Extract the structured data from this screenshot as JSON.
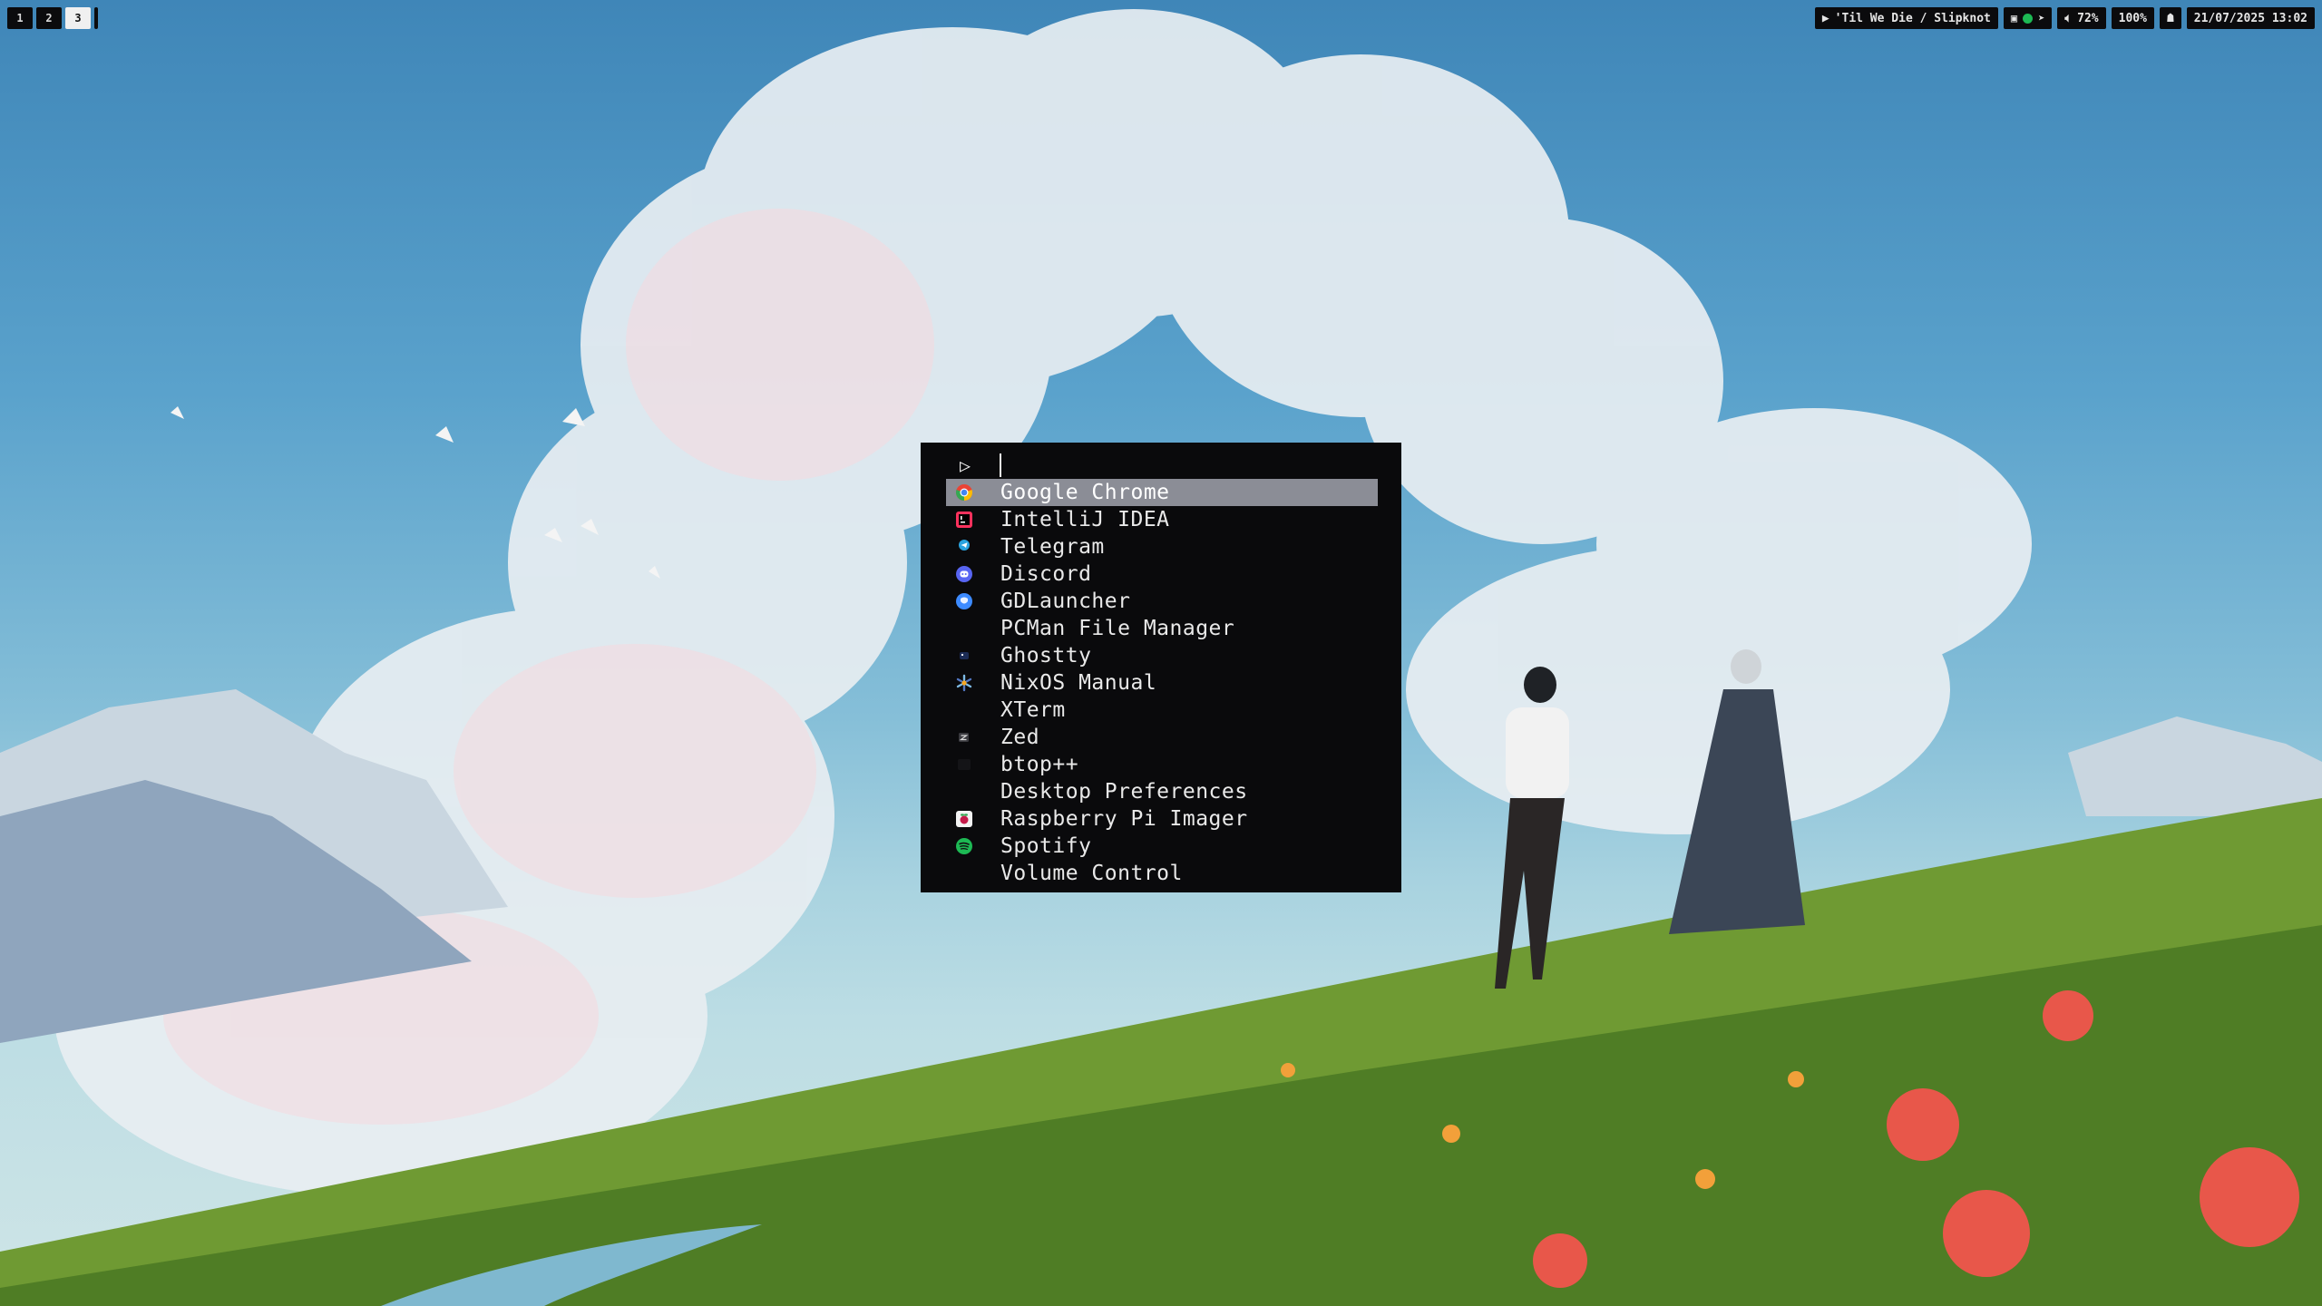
{
  "workspaces": [
    {
      "label": "1",
      "active": false
    },
    {
      "label": "2",
      "active": false
    },
    {
      "label": "3",
      "active": true
    }
  ],
  "statusbar": {
    "media": {
      "icon": "play-icon",
      "label": "'Til We Die / Slipknot"
    },
    "tray_icons": [
      "discord-tray-icon",
      "spotify-tray-icon",
      "telegram-tray-icon"
    ],
    "volume": {
      "icon": "speaker-icon",
      "label": "72%"
    },
    "brightness": {
      "label": "100%"
    },
    "extra_icon": "network-icon",
    "clock": "21/07/2025 13:02"
  },
  "launcher": {
    "prompt_icon": "play-outline-icon",
    "query": "",
    "items": [
      {
        "label": "Google Chrome",
        "icon": "chrome-icon",
        "selected": true
      },
      {
        "label": "IntelliJ IDEA",
        "icon": "intellij-icon",
        "selected": false
      },
      {
        "label": "Telegram",
        "icon": "telegram-icon",
        "selected": false
      },
      {
        "label": "Discord",
        "icon": "discord-icon",
        "selected": false
      },
      {
        "label": "GDLauncher",
        "icon": "gdlauncher-icon",
        "selected": false
      },
      {
        "label": "PCMan File Manager",
        "icon": "",
        "selected": false
      },
      {
        "label": "Ghostty",
        "icon": "ghostty-icon",
        "selected": false
      },
      {
        "label": "NixOS Manual",
        "icon": "nixos-icon",
        "selected": false
      },
      {
        "label": "XTerm",
        "icon": "",
        "selected": false
      },
      {
        "label": "Zed",
        "icon": "zed-icon",
        "selected": false
      },
      {
        "label": "btop++",
        "icon": "btop-icon",
        "selected": false
      },
      {
        "label": "Desktop Preferences",
        "icon": "",
        "selected": false
      },
      {
        "label": "Raspberry Pi Imager",
        "icon": "raspberry-pi-icon",
        "selected": false
      },
      {
        "label": "Spotify",
        "icon": "spotify-icon",
        "selected": false
      },
      {
        "label": "Volume Control",
        "icon": "",
        "selected": false
      }
    ]
  },
  "colors": {
    "bar_bg": "#0b0b0d",
    "launcher_bg": "#0a0a0c",
    "selection": "#8b8d96",
    "chrome_red": "#ea4335",
    "chrome_yellow": "#fbbc05",
    "chrome_green": "#34a853",
    "chrome_blue": "#4285f4",
    "discord": "#5865f2",
    "telegram": "#2aa3df",
    "spotify": "#1db954",
    "gdlauncher": "#3d8bff",
    "raspberry": "#c51a4a"
  }
}
